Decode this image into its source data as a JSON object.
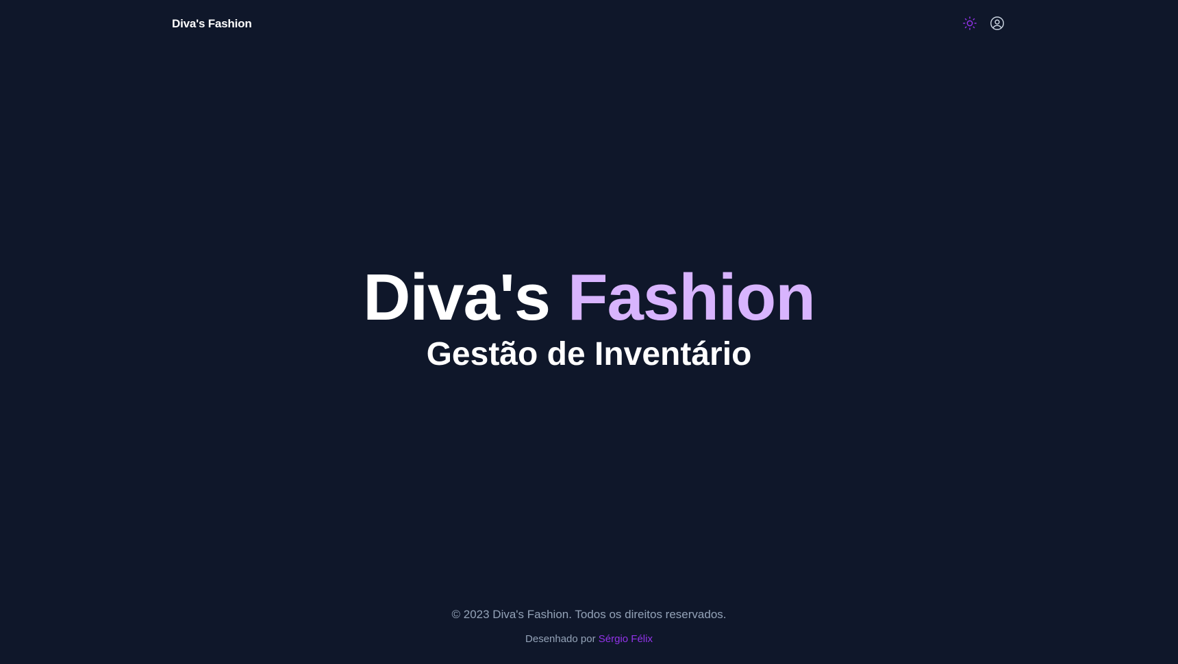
{
  "header": {
    "brand": "Diva's Fashion",
    "theme_icon": "sun-icon",
    "user_icon": "user-circle-icon"
  },
  "hero": {
    "title_part1": "Diva's",
    "title_part2": "Fashion",
    "subtitle": "Gestão de Inventário"
  },
  "footer": {
    "copyright": "© 2023 Diva's Fashion. Todos os direitos reservados.",
    "credit_prefix": "Desenhado por",
    "credit_name": "Sérgio Félix"
  },
  "colors": {
    "background": "#0f172a",
    "accent": "#d8b4fe",
    "link": "#9333ea",
    "icon_active": "#9333ea",
    "muted_text": "#94a3b8"
  }
}
